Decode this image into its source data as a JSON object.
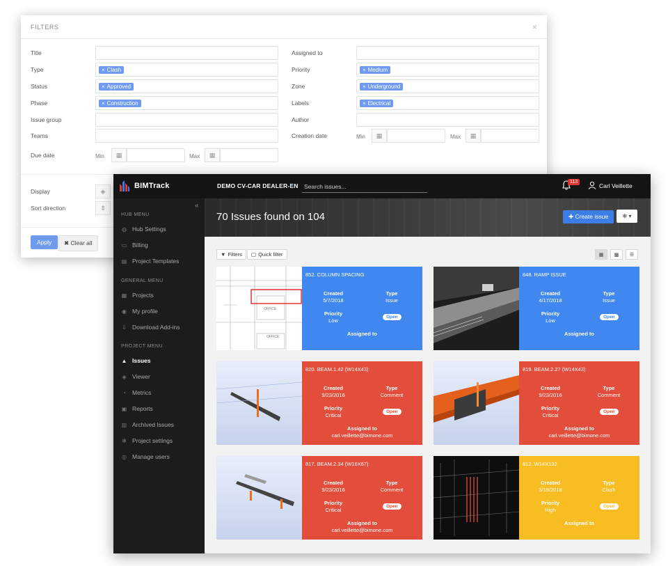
{
  "filters": {
    "title": "FILTERS",
    "close": "×",
    "left_labels": [
      "Title",
      "Type",
      "Status",
      "Phase",
      "Issue group",
      "Teams",
      "Due date"
    ],
    "right_labels": [
      "Assigned to",
      "Priority",
      "Zone",
      "Labels",
      "Author",
      "Creation date"
    ],
    "type_tag": "Clash",
    "status_tag": "Approved",
    "phase_tag": "Construction",
    "priority_tag": "Medium",
    "zone_tag": "Underground",
    "labels_tag": "Electrical",
    "min_label": "Min",
    "max_label": "Max",
    "display_label": "Display",
    "sort_label": "Sort direction",
    "apply": "Apply",
    "clear_all": "Clear all"
  },
  "app": {
    "brand": "BIMTrack",
    "project": "DEMO CV-CAR DEALER-EN",
    "search_placeholder": "Search issues...",
    "notifications": "113",
    "user": "Carl Veillette",
    "title": "70 Issues found on 104",
    "create_issue": "Create issue",
    "filters_btn": "Filters",
    "quick_filter_btn": "Quick filter",
    "collapse": "«"
  },
  "sidebar": {
    "hub_title": "HUB MENU",
    "hub_items": [
      "Hub Settings",
      "Billing",
      "Project Templates"
    ],
    "general_title": "GENERAL MENU",
    "general_items": [
      "Projects",
      "My profile",
      "Download Add-ins"
    ],
    "project_title": "PROJECT MENU",
    "project_items": [
      "Issues",
      "Viewer",
      "Metrics",
      "Reports",
      "Archived Issues",
      "Project settings",
      "Manage users"
    ]
  },
  "labels": {
    "created": "Created",
    "type": "Type",
    "priority": "Priority",
    "assigned_to": "Assigned to"
  },
  "issues": [
    {
      "name": "852. COLUMN SPACING",
      "created": "5/7/2018",
      "type": "Issue",
      "priority": "Low",
      "status": "Open",
      "assigned": ""
    },
    {
      "name": "848. RAMP ISSUE",
      "created": "4/17/2018",
      "type": "Issue",
      "priority": "Low",
      "status": "Open",
      "assigned": ""
    },
    {
      "name": "820. BEAM.1.42 (W14X43)",
      "created": "9/23/2016",
      "type": "Comment",
      "priority": "Critical",
      "status": "Open",
      "assigned": "carl.veillette@bimone.com"
    },
    {
      "name": "819. BEAM.2.27 (W14X43)",
      "created": "9/23/2016",
      "type": "Comment",
      "priority": "Critical",
      "status": "Open",
      "assigned": "carl.veillette@bimone.com"
    },
    {
      "name": "817. BEAM.2.34 (W16X67)",
      "created": "9/23/2016",
      "type": "Comment",
      "priority": "Critical",
      "status": "Open",
      "assigned": "carl.veillette@bimone.com"
    },
    {
      "name": "812. W14X132",
      "created": "3/19/2018",
      "type": "Clash",
      "priority": "High",
      "status": "Open",
      "assigned": ""
    }
  ],
  "colors": {
    "accent_blue": "#4088ef",
    "critical_red": "#e24d3c",
    "high_yellow": "#f7bd22",
    "tag_blue": "#6e9bf0"
  }
}
